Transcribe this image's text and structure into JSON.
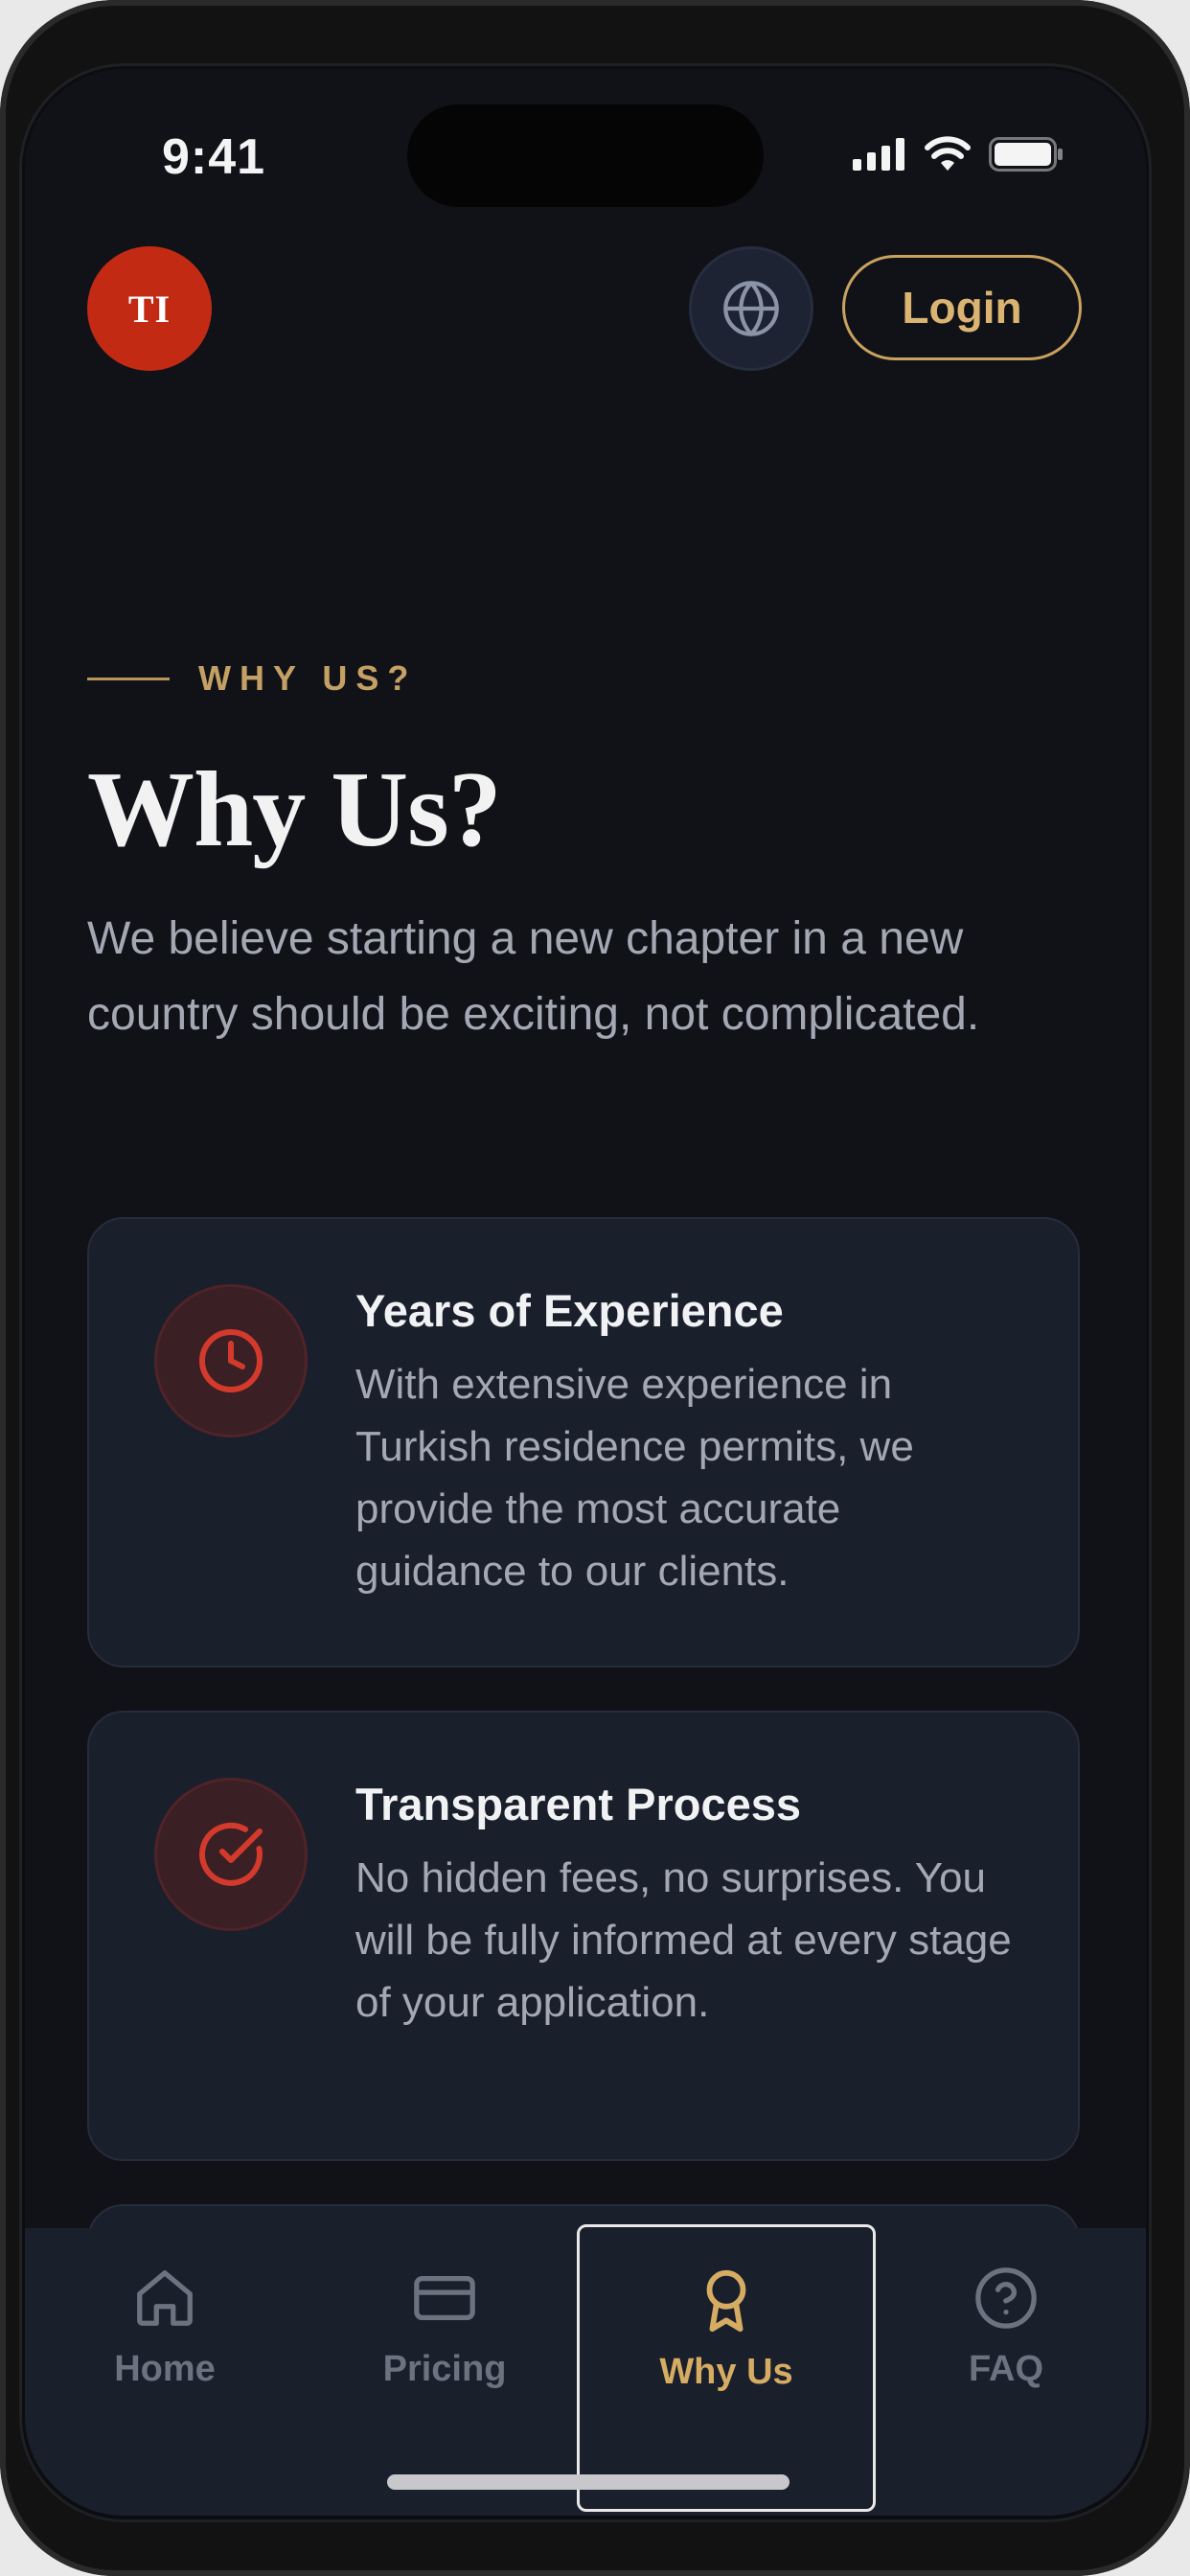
{
  "status_bar": {
    "time": "9:41",
    "icons": [
      "cellular-signal-icon",
      "wifi-icon",
      "battery-icon"
    ]
  },
  "header": {
    "logo_text": "TI",
    "language_icon": "globe-icon",
    "login_label": "Login"
  },
  "section": {
    "eyebrow": "WHY US?",
    "title": "Why Us?",
    "intro": "We believe starting a new chapter in a new country should be exciting, not complicated."
  },
  "features": [
    {
      "icon": "clock-icon",
      "title": "Years of Experience",
      "description": "With extensive experience in Turkish residence permits, we provide the most accurate guidance to our clients."
    },
    {
      "icon": "check-circle-icon",
      "title": "Transparent Process",
      "description": "No hidden fees, no surprises. You will be fully informed at every stage of your application."
    }
  ],
  "tab_bar": {
    "active": "Why Us",
    "tabs": [
      {
        "label": "Home",
        "icon": "home-icon"
      },
      {
        "label": "Pricing",
        "icon": "credit-card-icon"
      },
      {
        "label": "Why Us",
        "icon": "award-icon"
      },
      {
        "label": "FAQ",
        "icon": "help-circle-icon"
      }
    ]
  },
  "colors": {
    "background": "#111218",
    "card": "#1a1f2c",
    "accent_gold": "#d6ac62",
    "brand_red": "#c32a14",
    "icon_red": "#d33a2c",
    "text_primary": "#f2f2f3",
    "text_secondary": "#a3a8b3"
  }
}
